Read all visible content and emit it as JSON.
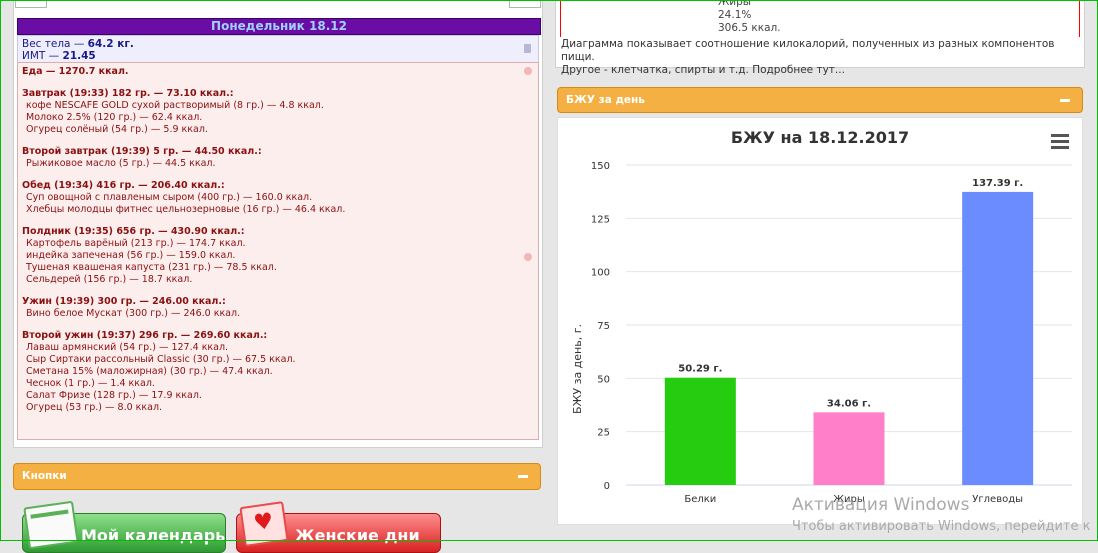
{
  "left": {
    "day_header": "Понедельник 18.12",
    "weight": {
      "label": "Вес тела — ",
      "value": "64.2 кг."
    },
    "bmi": {
      "label": "ИМТ — ",
      "value": "21.45"
    },
    "food_lines": [
      {
        "text": "Еда — 1270.7 ккал.",
        "style": "b"
      },
      {
        "text": "",
        "style": "gap"
      },
      {
        "text": "Завтрак (19:33) 182 гр. — 73.10 ккал.:",
        "style": "b"
      },
      {
        "text": "кофе NESCAFE GOLD сухой растворимый (8 гр.) — 4.8 ккал.",
        "style": "i"
      },
      {
        "text": "Молоко 2.5% (120 гр.) — 62.4 ккал.",
        "style": "i"
      },
      {
        "text": "Огурец солёный (54 гр.) — 5.9 ккал.",
        "style": "i"
      },
      {
        "text": "",
        "style": "gap"
      },
      {
        "text": "Второй завтрак (19:39) 5 гр. — 44.50 ккал.:",
        "style": "b"
      },
      {
        "text": "Рыжиковое масло (5 гр.) — 44.5 ккал.",
        "style": "i"
      },
      {
        "text": "",
        "style": "gap"
      },
      {
        "text": "Обед (19:34) 416 гр. — 206.40 ккал.:",
        "style": "b"
      },
      {
        "text": "Суп овощной с плавленым сыром (400 гр.) — 160.0 ккал.",
        "style": "i"
      },
      {
        "text": "Хлебцы молодцы фитнес цельнозерновые (16 гр.) — 46.4 ккал.",
        "style": "i"
      },
      {
        "text": "",
        "style": "gap"
      },
      {
        "text": "Полдник (19:35) 656 гр. — 430.90 ккал.:",
        "style": "b"
      },
      {
        "text": "Картофель варёный (213 гр.) — 174.7 ккал.",
        "style": "i"
      },
      {
        "text": "индейка запеченая (56 гр.) — 159.0 ккал.",
        "style": "i"
      },
      {
        "text": "Тушеная квашеная капуста (231 гр.) — 78.5 ккал.",
        "style": "i"
      },
      {
        "text": "Сельдерей (156 гр.) — 18.7 ккал.",
        "style": "i"
      },
      {
        "text": "",
        "style": "gap"
      },
      {
        "text": "Ужин (19:39) 300 гр. — 246.00 ккал.:",
        "style": "b"
      },
      {
        "text": "Вино белое Мускат (300 гр.) — 246.0 ккал.",
        "style": "i"
      },
      {
        "text": "",
        "style": "gap"
      },
      {
        "text": "Второй ужин (19:37) 296 гр. — 269.60 ккал.:",
        "style": "b"
      },
      {
        "text": "Лаваш армянский (54 гр.) — 127.4 ккал.",
        "style": "i"
      },
      {
        "text": "Сыр Сиртаки рассольный Classic (30 гр.) — 67.5 ккал.",
        "style": "i"
      },
      {
        "text": "Сметана 15% (маложирная) (30 гр.) — 47.4 ккал.",
        "style": "i"
      },
      {
        "text": "Чеснок (1 гр.) — 1.4 ккал.",
        "style": "i"
      },
      {
        "text": "Салат Фризе (128 гр.) — 17.9 ккал.",
        "style": "i"
      },
      {
        "text": "Огурец (53 гр.) — 8.0 ккал.",
        "style": "i"
      }
    ],
    "buttons_panel_title": "Кнопки",
    "btn_calendar": "Мой календарь",
    "btn_women": "Женские дни"
  },
  "right": {
    "pie_label": "Жиры",
    "pie_percent": "24.1%",
    "pie_kcal": "306.5 ккал.",
    "description_1": "Диаграмма показывает соотношение килокалорий, полученных из разных компонентов пищи.",
    "description_2": "Другое - клетчатка, спирты и т.д. Подробнее тут...",
    "panel_title": "БЖУ за день"
  },
  "chart_data": {
    "type": "bar",
    "title": "БЖУ на 18.12.2017",
    "ylabel": "БЖУ за день, г.",
    "xlabel": "",
    "categories": [
      "Белки",
      "Жиры",
      "Углеводы"
    ],
    "values": [
      50.29,
      34.06,
      137.39
    ],
    "data_labels": [
      "50.29 г.",
      "34.06 г.",
      "137.39 г."
    ],
    "colors": [
      "#25cc0f",
      "#ff80c8",
      "#6b8cff"
    ],
    "ylim": [
      0,
      150
    ],
    "yticks": [
      "0",
      "25",
      "50",
      "75",
      "100",
      "125",
      "150"
    ],
    "grid": true,
    "legend": "none"
  },
  "watermark": {
    "title": "Активация Windows",
    "subtitle": "Чтобы активировать Windows, перейдите к"
  }
}
